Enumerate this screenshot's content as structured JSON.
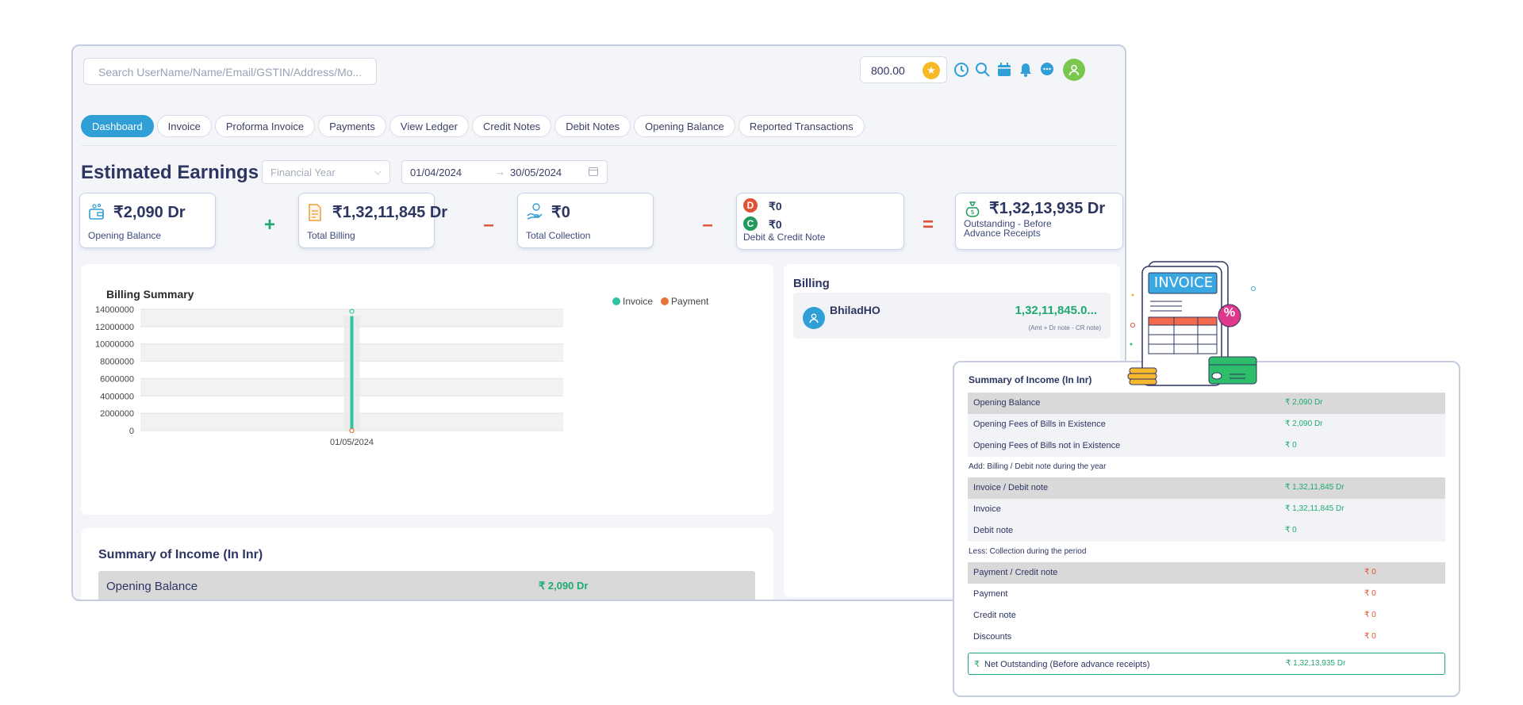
{
  "header": {
    "search_placeholder": "Search UserName/Name/Email/GSTIN/Address/Mo...",
    "coin_balance": "800.00"
  },
  "top_icons": [
    "clock-icon",
    "search-icon",
    "calendar-icon",
    "bell-icon",
    "chat-icon",
    "user-avatar-icon"
  ],
  "tabs": [
    {
      "label": "Dashboard",
      "active": true
    },
    {
      "label": "Invoice"
    },
    {
      "label": "Proforma Invoice"
    },
    {
      "label": "Payments"
    },
    {
      "label": "View Ledger"
    },
    {
      "label": "Credit Notes"
    },
    {
      "label": "Debit Notes"
    },
    {
      "label": "Opening Balance"
    },
    {
      "label": "Reported Transactions"
    }
  ],
  "earnings": {
    "title": "Estimated Earnings",
    "financial_year_placeholder": "Financial Year",
    "date_from": "01/04/2024",
    "date_to": "30/05/2024",
    "cards": {
      "opening": {
        "value": "₹2,090 Dr",
        "label": "Opening Balance"
      },
      "billing": {
        "value": "₹1,32,11,845 Dr",
        "label": "Total Billing"
      },
      "collection": {
        "value": "₹0",
        "label": "Total Collection"
      },
      "notes": {
        "debit_value": "₹0",
        "credit_value": "₹0",
        "debit_badge": "D",
        "credit_badge": "C",
        "label": "Debit & Credit Note"
      },
      "outstanding": {
        "value": "₹1,32,13,935 Dr",
        "label_line1": "Outstanding - Before",
        "label_line2": "Advance Receipts"
      }
    },
    "operators": {
      "plus": "+",
      "minus": "–",
      "equals": "="
    },
    "colors": {
      "plus": "#1fa971",
      "minus": "#e05236",
      "equals": "#e05236"
    }
  },
  "chart_data": {
    "type": "bar",
    "title": "Billing Summary",
    "categories": [
      "01/05/2024"
    ],
    "series": [
      {
        "name": "Invoice",
        "values": [
          13211845
        ],
        "color": "#2ec4a0"
      },
      {
        "name": "Payment",
        "values": [
          0
        ],
        "color": "#e8743b"
      }
    ],
    "ylim": [
      0,
      14000000
    ],
    "yticks": [
      0,
      2000000,
      4000000,
      6000000,
      8000000,
      10000000,
      12000000,
      14000000
    ],
    "legend": "top-right",
    "grid": true
  },
  "billing": {
    "title": "Billing",
    "name": "BhiladHO",
    "amount": "1,32,11,845.0...",
    "note": "(Amt + Dr note - CR note)"
  },
  "summary_main": {
    "title": "Summary of Income (In Inr)",
    "row_label": "Opening Balance",
    "row_value": "₹ 2,090 Dr"
  },
  "summary_popup": {
    "title": "Summary of Income (In Inr)",
    "rows": [
      {
        "label": "Opening Balance",
        "value": "₹ 2,090 Dr"
      },
      {
        "label": "Opening Fees of Bills in Existence",
        "value": "₹ 2,090 Dr"
      },
      {
        "label": "Opening Fees of Bills not in Existence",
        "value": "₹ 0"
      },
      {
        "label": "Invoice / Debit note",
        "value": "₹ 1,32,11,845 Dr"
      },
      {
        "label": "Invoice",
        "value": "₹ 1,32,11,845 Dr"
      },
      {
        "label": "Debit note",
        "value": "₹ 0"
      },
      {
        "label": "Payment / Credit note",
        "value": "₹ 0"
      },
      {
        "label": "Payment",
        "value": "₹ 0"
      },
      {
        "label": "Credit note",
        "value": "₹ 0"
      },
      {
        "label": "Discounts",
        "value": "₹ 0"
      }
    ],
    "section_add": "Add: Billing / Debit note during the year",
    "section_less": "Less: Collection during the period",
    "net_label": "Net Outstanding (Before advance receipts)",
    "net_currency": "₹",
    "net_value": "₹ 1,32,13,935 Dr"
  },
  "illustration": {
    "label": "INVOICE",
    "percent": "%"
  }
}
